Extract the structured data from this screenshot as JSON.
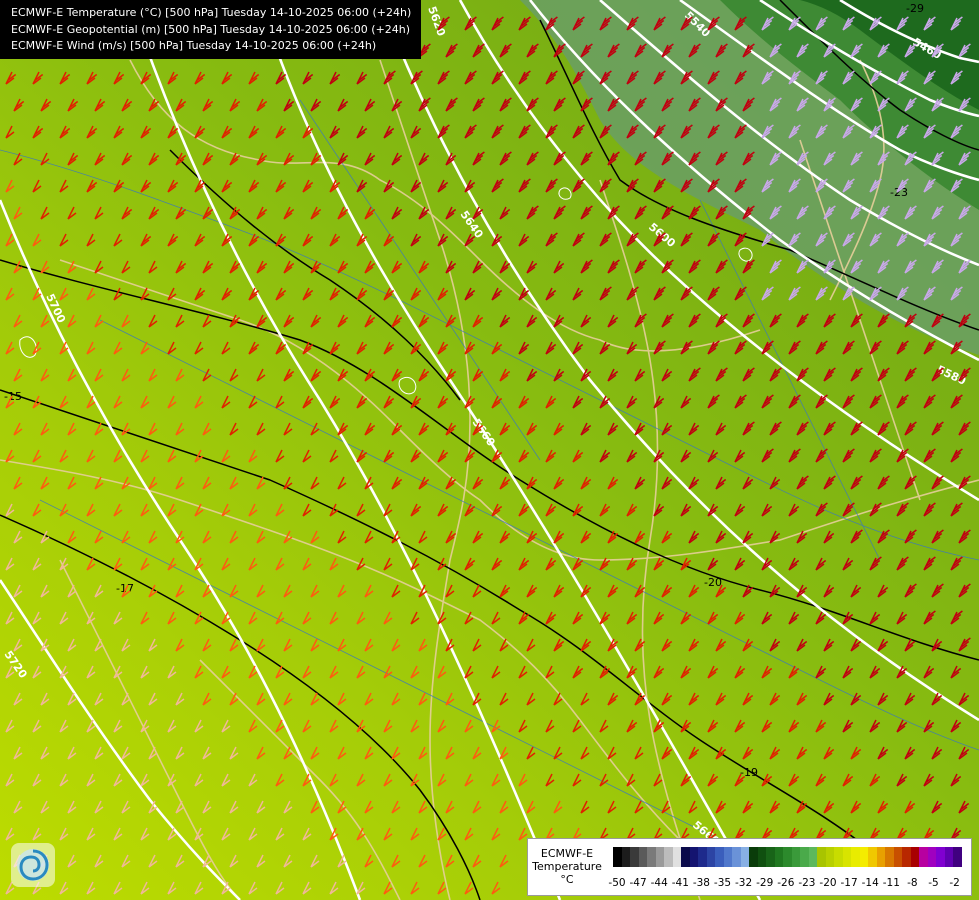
{
  "info": {
    "line1": "ECMWF-E Temperature (°C) [500 hPa] Tuesday 14-10-2025 06:00 (+24h)",
    "line2": "ECMWF-E Geopotential (m) [500 hPa] Tuesday 14-10-2025 06:00 (+24h)",
    "line3": "ECMWF-E Wind (m/s) [500 hPa] Tuesday 14-10-2025 06:00 (+24h)"
  },
  "legend": {
    "title_line1": "ECMWF-E",
    "title_line2": "Temperature",
    "title_line3": "°C",
    "colors": [
      "#000000",
      "#1c1c1c",
      "#3a3a3a",
      "#5a5a5a",
      "#7a7a7a",
      "#9a9a9a",
      "#bcbcbc",
      "#e0e0e0",
      "#0a0a4a",
      "#141470",
      "#1e2a8c",
      "#2c44a4",
      "#3a5ebc",
      "#5078cc",
      "#6a92d8",
      "#88b0e4",
      "#0a3c0a",
      "#105010",
      "#186418",
      "#207820",
      "#2c8a2c",
      "#3a9a3a",
      "#4aaa4a",
      "#5cb85c",
      "#a8c400",
      "#b8d000",
      "#c8dc00",
      "#d8e400",
      "#e8ec00",
      "#f4ec00",
      "#f0c800",
      "#e8a000",
      "#d87800",
      "#c85000",
      "#b82800",
      "#a80000",
      "#b800a0",
      "#a000c0",
      "#8000d0",
      "#6000b0",
      "#400080"
    ],
    "ticks": [
      "-50",
      "-47",
      "-44",
      "-41",
      "-38",
      "-35",
      "-32",
      "-29",
      "-26",
      "-23",
      "-20",
      "-17",
      "-14",
      "-11",
      "-8",
      "-5",
      "-2"
    ]
  },
  "geopotential_labels": [
    "5460",
    "5540",
    "5580",
    "5600",
    "5620",
    "5640",
    "5660",
    "5660",
    "5700",
    "5720"
  ],
  "temperature_labels": [
    "-29",
    "-23",
    "-20",
    "-19",
    "-17",
    "-15"
  ]
}
